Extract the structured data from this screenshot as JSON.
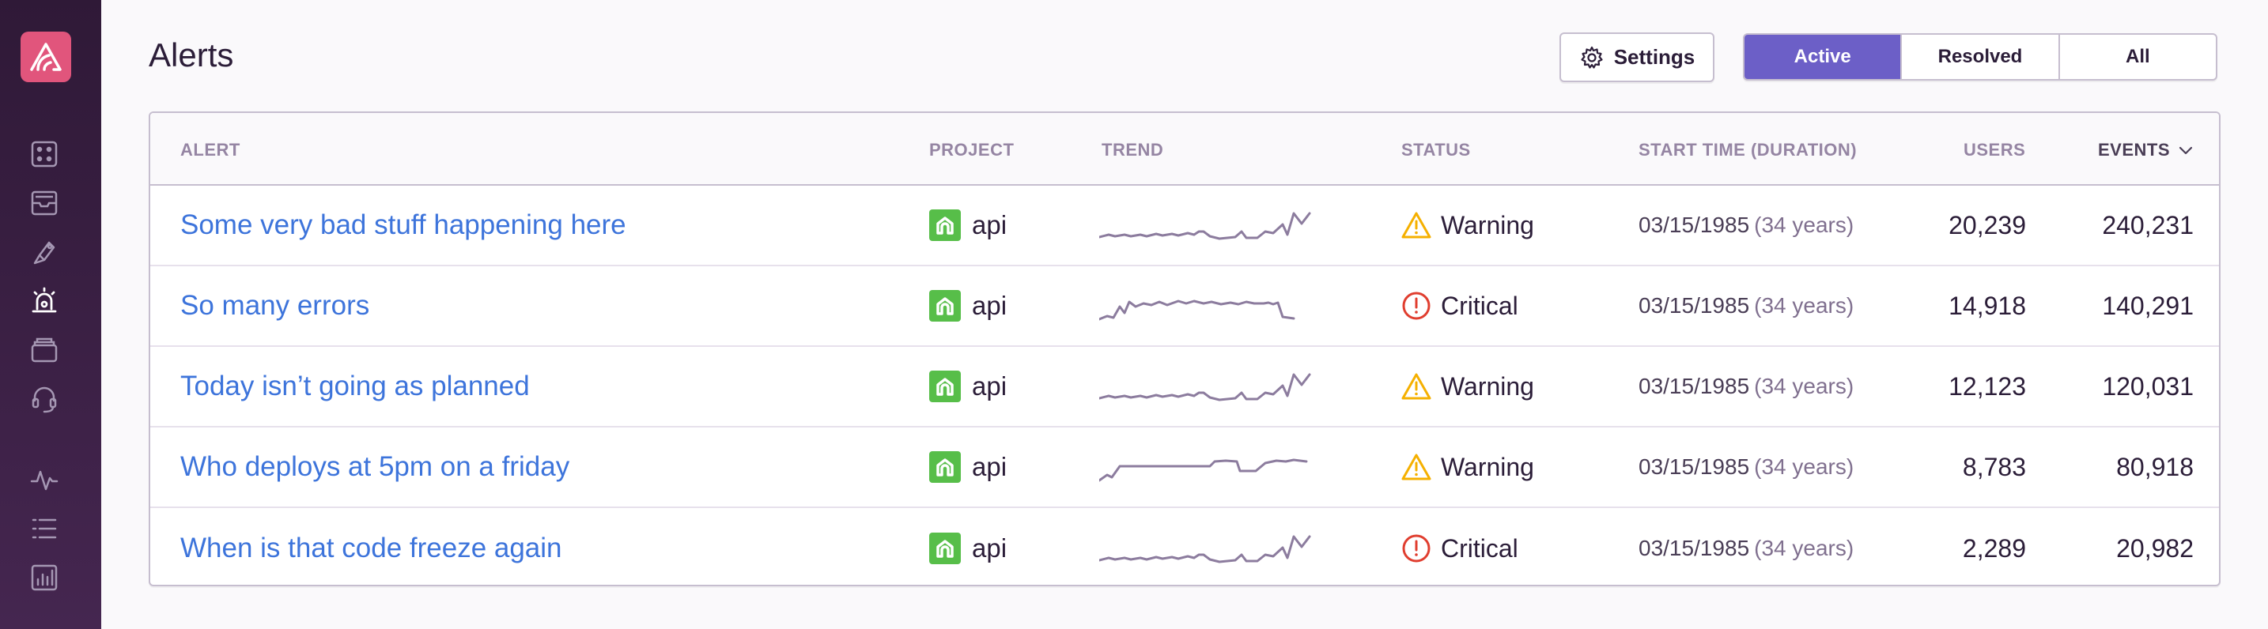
{
  "sidebar": {
    "icons": [
      {
        "name": "projects-icon",
        "active": false
      },
      {
        "name": "issues-icon",
        "active": false
      },
      {
        "name": "releases-icon",
        "active": false
      },
      {
        "name": "alerts-icon",
        "active": true
      },
      {
        "name": "archive-icon",
        "active": false
      },
      {
        "name": "support-icon",
        "active": false
      },
      {
        "name": "activity-icon",
        "active": false
      },
      {
        "name": "list-icon",
        "active": false
      },
      {
        "name": "stats-icon",
        "active": false
      }
    ]
  },
  "header": {
    "title": "Alerts",
    "settings_label": "Settings",
    "filters": [
      "Active",
      "Resolved",
      "All"
    ],
    "selected_filter": "Active"
  },
  "table": {
    "columns": {
      "alert": "Alert",
      "project": "Project",
      "trend": "Trend",
      "status": "Status",
      "start_time": "Start Time (Duration)",
      "users": "Users",
      "events": "Events"
    },
    "rows": [
      {
        "title": "Some very bad stuff happening here",
        "project": "api",
        "status": "Warning",
        "start": "03/15/1985",
        "duration": "(34 years)",
        "users": "20,239",
        "events": "240,231"
      },
      {
        "title": "So many errors",
        "project": "api",
        "status": "Critical",
        "start": "03/15/1985",
        "duration": "(34 years)",
        "users": "14,918",
        "events": "140,291"
      },
      {
        "title": "Today isn’t going as planned",
        "project": "api",
        "status": "Warning",
        "start": "03/15/1985",
        "duration": "(34 years)",
        "users": "12,123",
        "events": "120,031"
      },
      {
        "title": "Who deploys at 5pm on a friday",
        "project": "api",
        "status": "Warning",
        "start": "03/15/1985",
        "duration": "(34 years)",
        "users": "8,783",
        "events": "80,918"
      },
      {
        "title": "When is that code freeze again",
        "project": "api",
        "status": "Critical",
        "start": "03/15/1985",
        "duration": "(34 years)",
        "users": "2,289",
        "events": "20,982"
      }
    ]
  },
  "colors": {
    "accent": "#6c5fc7",
    "link": "#3d74db",
    "warning": "#f5b000",
    "critical": "#e03e2f",
    "project_badge": "#57be49"
  }
}
